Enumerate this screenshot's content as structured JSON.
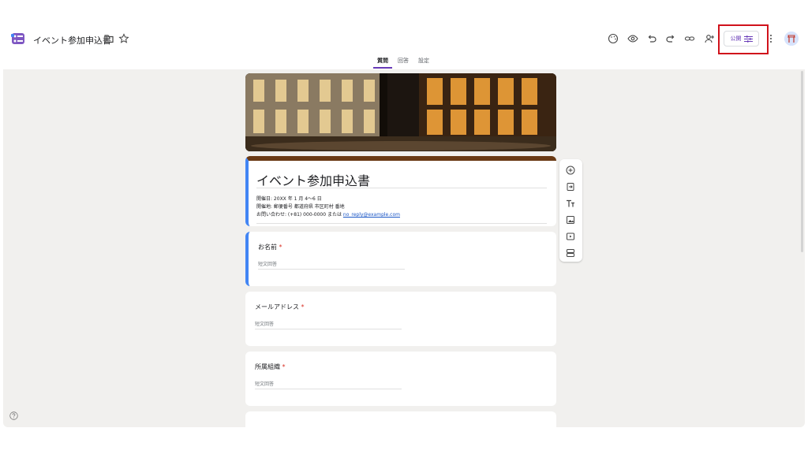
{
  "header": {
    "doc_title": "イベント参加申込書",
    "publish_label": "公開"
  },
  "tabs": [
    {
      "label": "質問"
    },
    {
      "label": "回答"
    },
    {
      "label": "設定"
    }
  ],
  "form": {
    "title": "イベント参加申込書",
    "desc_line1": "開催日: 20XX 年 1 月 4〜6 日",
    "desc_line2": "開催地: 郵便番号 都道府県 市区町村 番地",
    "desc_line3_prefix": "お問い合わせ: (+81) 000-0000 または ",
    "desc_email": "no_reply@example.com"
  },
  "questions": [
    {
      "label": "お名前",
      "required_mark": "*",
      "placeholder": "短文回答"
    },
    {
      "label": "メールアドレス",
      "required_mark": "*",
      "placeholder": "短文回答"
    },
    {
      "label": "所属組織",
      "required_mark": "*",
      "placeholder": "短文回答"
    }
  ],
  "colors": {
    "accent": "#673ab7",
    "header_border": "#6a3a15",
    "selected_border": "#4285f4",
    "highlight_box": "#d0121b"
  }
}
